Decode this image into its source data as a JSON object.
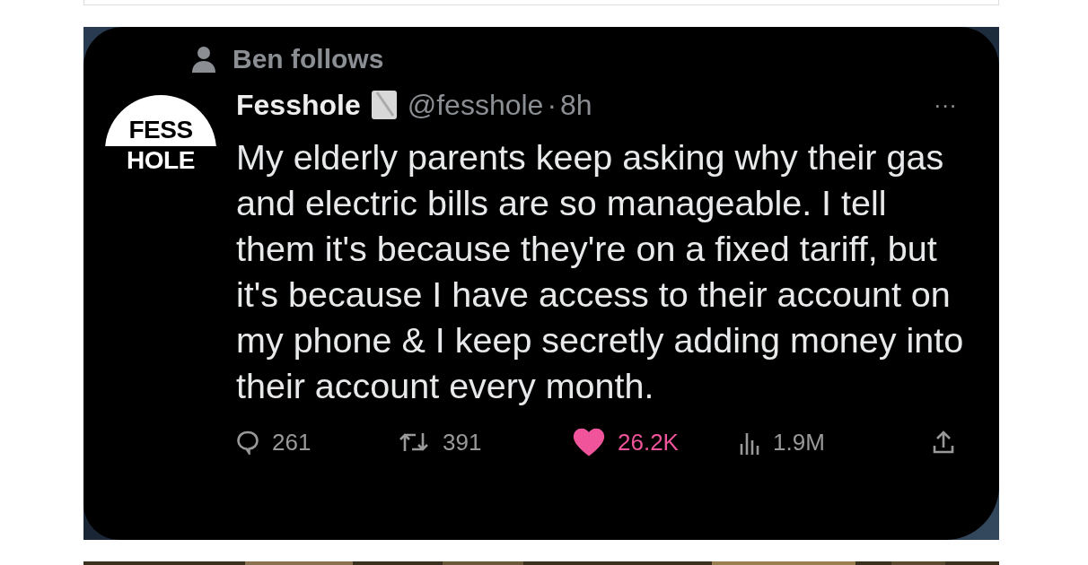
{
  "tweet": {
    "social_context": "Ben follows",
    "avatar": {
      "top_text": "FESS",
      "bottom_text": "HOLE"
    },
    "author": {
      "name": "Fesshole",
      "handle": "@fesshole",
      "separator": "·",
      "time": "8h"
    },
    "more": "···",
    "text": "My elderly parents keep asking why their gas and electric bills are so manageable. I tell them it's because they're on a fixed tariff, but it's because I have access to their account on my phone & I keep secretly adding money into their account every month.",
    "actions": [
      {
        "kind": "reply",
        "count": "261",
        "selected": false
      },
      {
        "kind": "repost",
        "count": "391",
        "selected": false
      },
      {
        "kind": "like",
        "count": "26.2K",
        "selected": true
      },
      {
        "kind": "views",
        "count": "1.9M",
        "selected": false
      },
      {
        "kind": "share",
        "selected": false
      }
    ]
  }
}
